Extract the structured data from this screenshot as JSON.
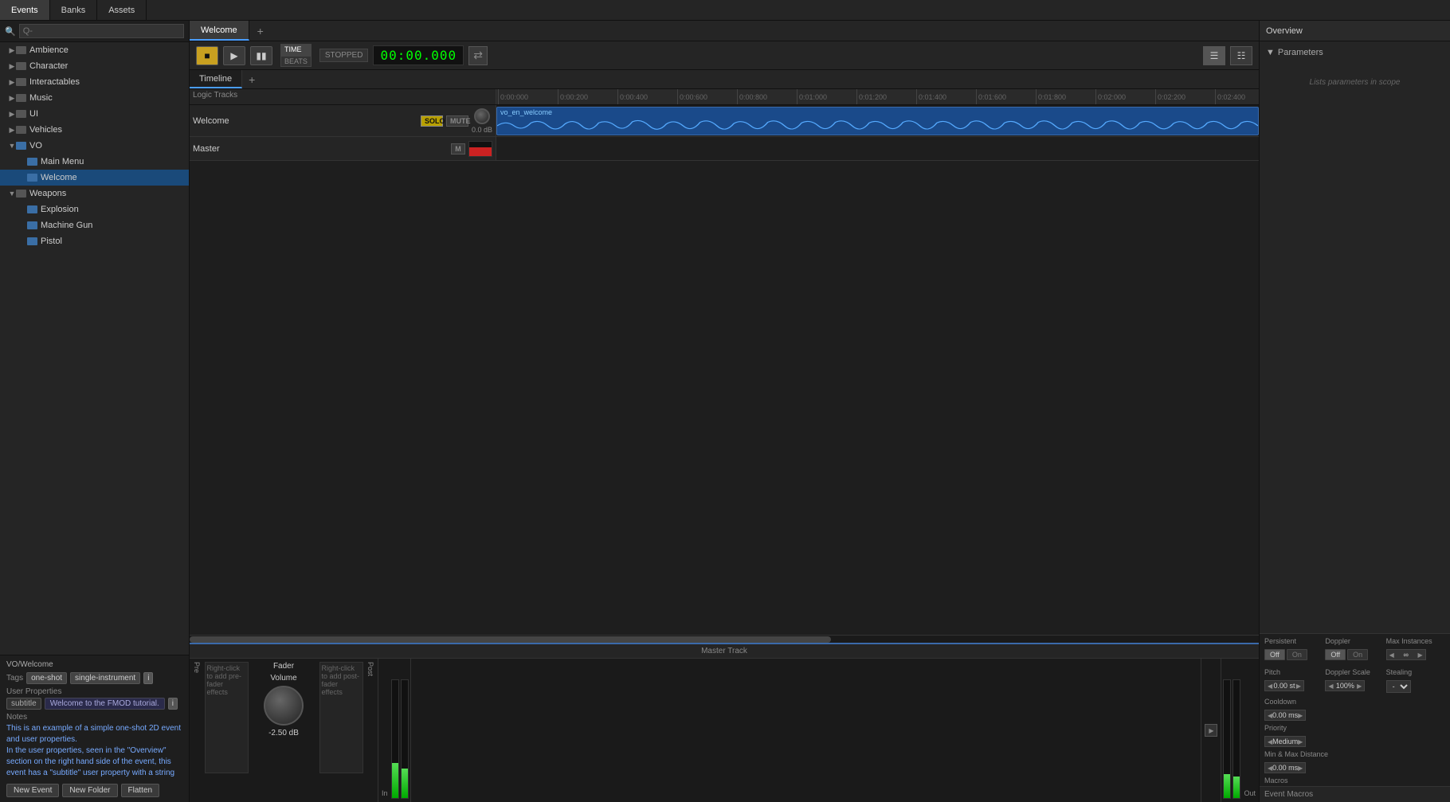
{
  "topNav": {
    "tabs": [
      {
        "id": "events",
        "label": "Events",
        "active": true
      },
      {
        "id": "banks",
        "label": "Banks",
        "active": false
      },
      {
        "id": "assets",
        "label": "Assets",
        "active": false
      }
    ]
  },
  "sidebar": {
    "search": {
      "placeholder": "Q-",
      "value": ""
    },
    "tree": [
      {
        "id": "ambience",
        "label": "Ambience",
        "type": "folder",
        "indent": 0,
        "expanded": false
      },
      {
        "id": "character",
        "label": "Character",
        "type": "folder",
        "indent": 0,
        "expanded": false
      },
      {
        "id": "interactables",
        "label": "Interactables",
        "type": "folder",
        "indent": 0,
        "expanded": false
      },
      {
        "id": "music",
        "label": "Music",
        "type": "folder",
        "indent": 0,
        "expanded": false
      },
      {
        "id": "ui",
        "label": "UI",
        "type": "folder",
        "indent": 0,
        "expanded": false
      },
      {
        "id": "vehicles",
        "label": "Vehicles",
        "type": "folder",
        "indent": 0,
        "expanded": false
      },
      {
        "id": "vo",
        "label": "VO",
        "type": "folder",
        "indent": 0,
        "expanded": true
      },
      {
        "id": "main-menu",
        "label": "Main Menu",
        "type": "event",
        "indent": 1,
        "expanded": false
      },
      {
        "id": "welcome",
        "label": "Welcome",
        "type": "event",
        "indent": 1,
        "expanded": false,
        "selected": true
      },
      {
        "id": "weapons",
        "label": "Weapons",
        "type": "folder",
        "indent": 0,
        "expanded": true
      },
      {
        "id": "explosion",
        "label": "Explosion",
        "type": "event",
        "indent": 1,
        "expanded": false
      },
      {
        "id": "machine-gun",
        "label": "Machine Gun",
        "type": "event",
        "indent": 1,
        "expanded": false
      },
      {
        "id": "pistol",
        "label": "Pistol",
        "type": "event",
        "indent": 1,
        "expanded": false
      }
    ]
  },
  "bottomLeft": {
    "path": "VO/Welcome",
    "tags": {
      "label": "Tags",
      "items": [
        "one-shot",
        "single-instrument"
      ]
    },
    "userProperties": {
      "label": "User Properties",
      "items": [
        {
          "key": "subtitle",
          "value": "Welcome to the FMOD tutorial."
        }
      ]
    },
    "notes": {
      "label": "Notes",
      "text": "This is an example of a simple one-shot 2D event and user properties.",
      "text2": "In the user properties, seen in the \"Overview\" section on the right hand side of the event, this event has a \"subtitle\" user property with a string"
    },
    "buttons": [
      "New Event",
      "New Folder",
      "Flatten"
    ]
  },
  "eventTab": {
    "label": "Welcome",
    "addLabel": "+"
  },
  "transport": {
    "timeMode1": "TIME",
    "timeMode2": "BEATS",
    "status": "STOPPED",
    "time": "00:00.000",
    "loopSymbol": "⇄"
  },
  "timeline": {
    "tabLabel": "Timeline",
    "addLabel": "+",
    "logicTracksLabel": "Logic Tracks",
    "rulerMarks": [
      "0:00:000",
      "0:00:200",
      "0:00:400",
      "0:00:600",
      "0:00:800",
      "0:01:000",
      "0:01:200",
      "0:01:400",
      "0:01:600",
      "0:01:800",
      "0:02:000",
      "0:02:200",
      "0:02:400"
    ],
    "tracks": [
      {
        "id": "welcome",
        "name": "Welcome",
        "soloLabel": "SOLO",
        "muteLabel": "MUTE",
        "db": "0.0 dB",
        "clipLabel": "vo_en_welcome"
      }
    ],
    "masterLabel": "Master"
  },
  "bottomSection": {
    "masterTrackLabel": "Master Track",
    "faderLabel": "Fader",
    "volumeLabel": "Volume",
    "volumeDb": "-2.50 dB",
    "preLabel": "Pre",
    "postLabel": "Post",
    "inLabel": "In",
    "outLabel": "Out"
  },
  "rightPanel": {
    "title": "Overview",
    "parametersLabel": "Parameters",
    "parametersPlaceholder": "Lists parameters in scope",
    "persistent": {
      "label": "Persistent",
      "offLabel": "Off",
      "onLabel": "On"
    },
    "doppler": {
      "label": "Doppler",
      "offLabel": "Off",
      "onLabel": "On"
    },
    "maxInstances": {
      "label": "Max Instances",
      "value": "∞"
    },
    "cooldown": {
      "label": "Cooldown",
      "value": "0.00 ms"
    },
    "pitch": {
      "label": "Pitch",
      "value": "0.00 st"
    },
    "dopplerScale": {
      "label": "Doppler Scale",
      "value": "100%"
    },
    "stealing": {
      "label": "Stealing",
      "value": "-"
    },
    "priority": {
      "label": "Priority",
      "value": "Medium"
    },
    "minMaxDistance": {
      "label": "Min & Max Distance",
      "value": "0.00 ms"
    },
    "macrosLabel": "Macros",
    "eventMacrosLabel": "Event Macros"
  }
}
